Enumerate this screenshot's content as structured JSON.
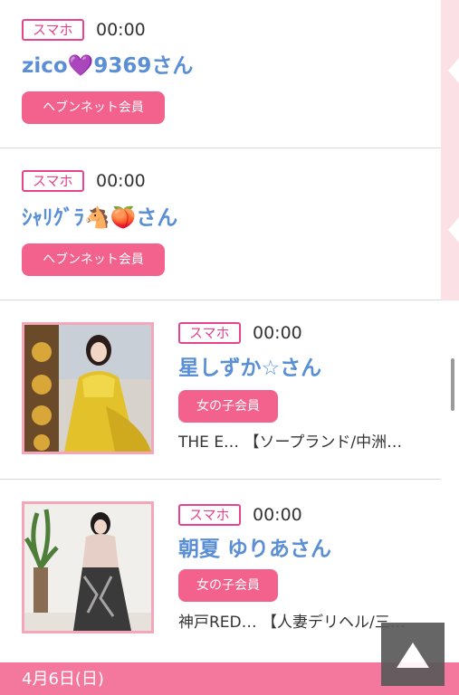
{
  "entries": [
    {
      "device": "スマホ",
      "time": "00:00",
      "name": "zico💜9369さん",
      "member_type": "ヘブンネット会員"
    },
    {
      "device": "スマホ",
      "time": "00:00",
      "name": "ｼｬﾘｸﾞﾗ🐴🍑さん",
      "member_type": "ヘブンネット会員"
    },
    {
      "device": "スマホ",
      "time": "00:00",
      "name": "星しずか☆さん",
      "member_type": "女の子会員",
      "shop": "THE E… 【ソープランド/中洲…"
    },
    {
      "device": "スマホ",
      "time": "00:00",
      "name": "朝夏 ゆりあさん",
      "member_type": "女の子会員",
      "shop": "神戸RED… 【人妻デリヘル/三…"
    }
  ],
  "date_header": "4月6日(日)",
  "scroll_top_icon": "up-triangle-icon",
  "colors": {
    "accent": "#e8448e",
    "badge_bg": "#f2628c",
    "name": "#5a8fd6",
    "date_bar": "#f4789e"
  }
}
